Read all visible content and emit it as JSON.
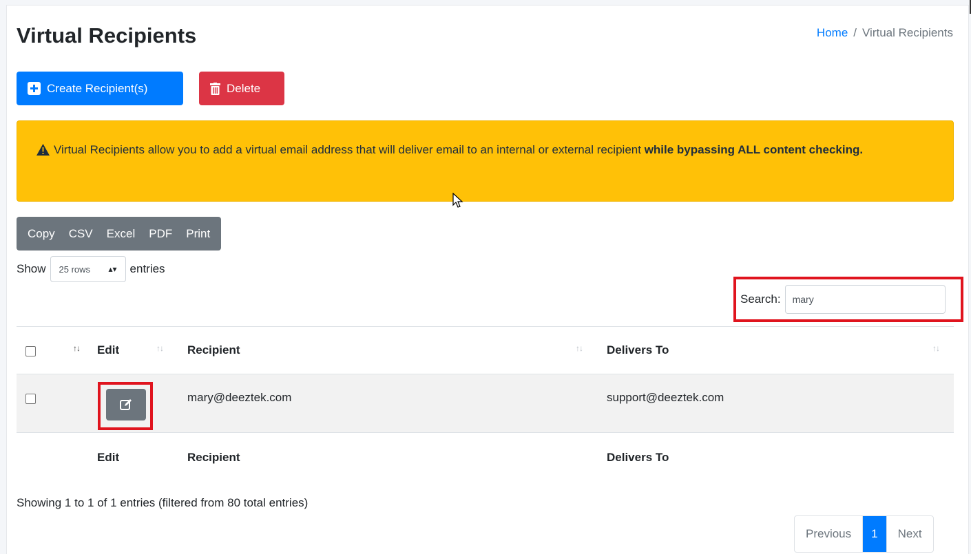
{
  "header": {
    "title": "Virtual Recipients",
    "breadcrumb": {
      "home": "Home",
      "separator": "/",
      "current": "Virtual Recipients"
    }
  },
  "actions": {
    "create_label": "Create Recipient(s)",
    "delete_label": "Delete"
  },
  "alert": {
    "text": "Virtual Recipients allow you to add a virtual email address that will deliver email to an internal or external recipient",
    "bold_text": "while bypassing ALL content checking."
  },
  "export_buttons": [
    "Copy",
    "CSV",
    "Excel",
    "PDF",
    "Print"
  ],
  "length_menu": {
    "prefix": "Show",
    "selected": "25 rows",
    "suffix": "entries"
  },
  "search": {
    "label": "Search:",
    "value": "mary"
  },
  "table": {
    "columns": [
      "Edit",
      "Recipient",
      "Delivers To"
    ],
    "rows": [
      {
        "recipient": "mary@deeztek.com",
        "delivers_to": "support@deeztek.com"
      }
    ]
  },
  "info": "Showing 1 to 1 of 1 entries (filtered from 80 total entries)",
  "pagination": {
    "previous": "Previous",
    "current": "1",
    "next": "Next"
  },
  "colors": {
    "primary": "#007bff",
    "danger": "#dc3545",
    "warning": "#ffc107",
    "secondary": "#6c757d",
    "highlight": "#e0141e"
  }
}
